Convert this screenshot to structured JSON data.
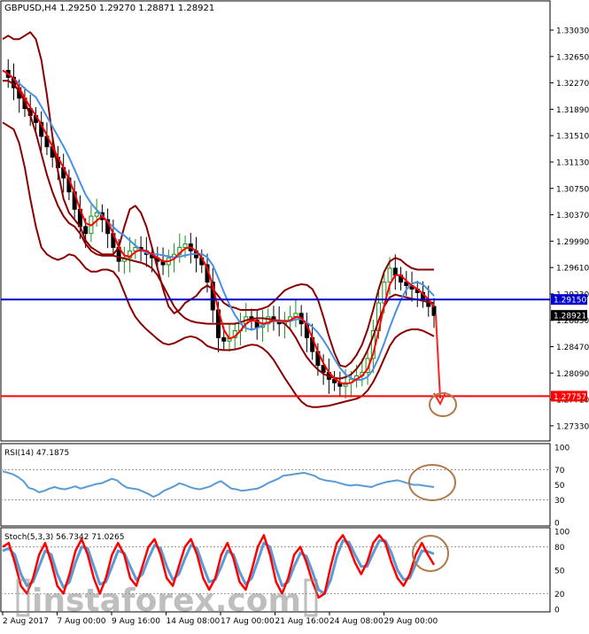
{
  "chart_data": {
    "type": "line",
    "title": "GBPUSD,H4  1.29250 1.29270 1.28871 1.28921",
    "main": {
      "ylim": [
        1.2715,
        1.334
      ],
      "yticks": [
        "1.33030",
        "1.32650",
        "1.32270",
        "1.31890",
        "1.31510",
        "1.31130",
        "1.30750",
        "1.30370",
        "1.29990",
        "1.29610",
        "1.29230",
        "1.28850",
        "1.28470",
        "1.28090",
        "1.27710",
        "1.27330"
      ],
      "levels": [
        {
          "name": "resistance",
          "value": 1.2915,
          "label": "1.29150",
          "color": "#0000cc"
        },
        {
          "name": "support",
          "value": 1.27757,
          "label": "1.27757",
          "color": "#ff0000"
        },
        {
          "name": "last",
          "value": 1.28921,
          "label": "1.28921",
          "color": "#000000"
        }
      ],
      "close": [
        1.3245,
        1.3235,
        1.322,
        1.3205,
        1.319,
        1.318,
        1.317,
        1.315,
        1.3135,
        1.312,
        1.3105,
        1.309,
        1.307,
        1.3045,
        1.302,
        1.301,
        1.3035,
        1.304,
        1.303,
        1.301,
        1.299,
        1.297,
        1.2975,
        1.2985,
        1.299,
        1.2985,
        1.298,
        1.2975,
        1.297,
        1.2965,
        1.2975,
        1.298,
        1.299,
        1.2995,
        1.2985,
        1.2975,
        1.2965,
        1.294,
        1.29,
        1.286,
        1.2855,
        1.286,
        1.287,
        1.288,
        1.289,
        1.2885,
        1.2875,
        1.288,
        1.289,
        1.2885,
        1.288,
        1.2885,
        1.289,
        1.2895,
        1.288,
        1.286,
        1.284,
        1.282,
        1.281,
        1.28,
        1.2795,
        1.279,
        1.2795,
        1.28,
        1.2805,
        1.281,
        1.283,
        1.287,
        1.291,
        1.294,
        1.296,
        1.295,
        1.294,
        1.2935,
        1.293,
        1.2925,
        1.2915,
        1.2905,
        1.2892
      ],
      "upper_band": [
        1.329,
        1.3295,
        1.329,
        1.329,
        1.3295,
        1.33,
        1.329,
        1.326,
        1.321,
        1.315,
        1.31,
        1.306,
        1.304,
        1.303,
        1.302,
        1.3,
        1.299,
        1.2985,
        1.298,
        1.298,
        1.298,
        1.299,
        1.302,
        1.3045,
        1.305,
        1.304,
        1.302,
        1.299,
        1.296,
        1.293,
        1.2905,
        1.2895,
        1.29,
        1.291,
        1.2915,
        1.292,
        1.293,
        1.2935,
        1.293,
        1.292,
        1.291,
        1.2905,
        1.2903,
        1.29,
        1.29,
        1.29,
        1.29,
        1.2902,
        1.2905,
        1.2912,
        1.292,
        1.2928,
        1.2932,
        1.2935,
        1.2937,
        1.2936,
        1.293,
        1.2915,
        1.289,
        1.2862,
        1.2838,
        1.282,
        1.2818,
        1.2824,
        1.2835,
        1.285,
        1.2872,
        1.29,
        1.293,
        1.2955,
        1.297,
        1.2975,
        1.2972,
        1.2965,
        1.296,
        1.2958,
        1.2958,
        1.2958,
        1.2958
      ],
      "middle_band": [
        1.323,
        1.323,
        1.3225,
        1.3215,
        1.32,
        1.318,
        1.3155,
        1.3125,
        1.3095,
        1.307,
        1.305,
        1.3035,
        1.3025,
        1.302,
        1.301,
        1.2995,
        1.2985,
        1.298,
        1.2978,
        1.2978,
        1.2978,
        1.2976,
        1.2974,
        1.2972,
        1.297,
        1.2968,
        1.2965,
        1.296,
        1.295,
        1.2935,
        1.292,
        1.2905,
        1.2895,
        1.2888,
        1.2884,
        1.2882,
        1.2881,
        1.288,
        1.288,
        1.288,
        1.288,
        1.288,
        1.288,
        1.2882,
        1.2885,
        1.2887,
        1.2888,
        1.2888,
        1.2887,
        1.2886,
        1.2884,
        1.288,
        1.2872,
        1.286,
        1.2845,
        1.2832,
        1.2822,
        1.2814,
        1.2808,
        1.2804,
        1.2802,
        1.2801,
        1.2803,
        1.2807,
        1.2815,
        1.2826,
        1.2842,
        1.2862,
        1.2885,
        1.2905,
        1.2918,
        1.2922,
        1.292,
        1.2918,
        1.2916,
        1.2915,
        1.2913,
        1.2911,
        1.291
      ],
      "lower_band": [
        1.317,
        1.3165,
        1.316,
        1.314,
        1.3105,
        1.306,
        1.302,
        1.299,
        1.298,
        1.2975,
        1.2972,
        1.2975,
        1.298,
        1.2978,
        1.297,
        1.296,
        1.2955,
        1.2955,
        1.2958,
        1.2958,
        1.2955,
        1.2945,
        1.2925,
        1.2905,
        1.289,
        1.288,
        1.2872,
        1.2865,
        1.2858,
        1.2852,
        1.285,
        1.2852,
        1.2856,
        1.286,
        1.2862,
        1.286,
        1.2855,
        1.2848,
        1.2845,
        1.2843,
        1.2842,
        1.2842,
        1.2843,
        1.2845,
        1.2848,
        1.285,
        1.2849,
        1.2845,
        1.2838,
        1.2828,
        1.2815,
        1.2802,
        1.279,
        1.2778,
        1.2768,
        1.2762,
        1.276,
        1.276,
        1.2761,
        1.2762,
        1.2764,
        1.2766,
        1.2768,
        1.277,
        1.2772,
        1.2776,
        1.2784,
        1.2796,
        1.2812,
        1.283,
        1.2848,
        1.286,
        1.2866,
        1.287,
        1.2872,
        1.2872,
        1.287,
        1.2866,
        1.2862
      ]
    },
    "rsi": {
      "label": "RSI(14) 47.1875",
      "ylim": [
        0,
        100
      ],
      "yticks": [
        "100",
        "70",
        "50",
        "30",
        "0"
      ],
      "values": [
        68,
        66,
        64,
        60,
        55,
        46,
        44,
        40,
        42,
        45,
        47,
        45,
        44,
        46,
        48,
        45,
        47,
        49,
        51,
        52,
        55,
        58,
        56,
        50,
        46,
        45,
        44,
        41,
        38,
        34,
        37,
        42,
        45,
        48,
        52,
        50,
        47,
        45,
        44,
        46,
        48,
        52,
        55,
        50,
        45,
        44,
        42,
        43,
        44,
        45,
        48,
        52,
        55,
        58,
        62,
        63,
        64,
        65,
        66,
        64,
        62,
        58,
        56,
        55,
        54,
        52,
        50,
        49,
        50,
        49,
        48,
        47,
        50,
        52,
        54,
        55,
        56,
        54,
        52,
        50,
        50,
        49,
        48,
        47
      ]
    },
    "stoch": {
      "label": "Stoch(5,3,3) 56.7342 71.0265",
      "ylim": [
        0,
        100
      ],
      "yticks": [
        "100",
        "80",
        "50",
        "20",
        "0"
      ],
      "k": [
        80,
        85,
        60,
        30,
        20,
        40,
        70,
        85,
        60,
        30,
        20,
        45,
        75,
        90,
        70,
        40,
        20,
        40,
        70,
        85,
        70,
        40,
        30,
        55,
        80,
        90,
        70,
        40,
        30,
        55,
        80,
        90,
        70,
        40,
        25,
        40,
        70,
        85,
        65,
        35,
        25,
        50,
        80,
        95,
        70,
        35,
        20,
        40,
        70,
        80,
        60,
        35,
        15,
        20,
        55,
        85,
        95,
        80,
        60,
        45,
        60,
        85,
        95,
        85,
        60,
        40,
        30,
        45,
        70,
        85,
        70,
        57
      ],
      "d": [
        75,
        78,
        70,
        45,
        30,
        35,
        55,
        75,
        70,
        45,
        28,
        35,
        60,
        80,
        78,
        55,
        32,
        35,
        55,
        75,
        72,
        55,
        38,
        45,
        65,
        82,
        78,
        55,
        38,
        45,
        65,
        82,
        78,
        55,
        35,
        38,
        55,
        75,
        70,
        48,
        32,
        40,
        62,
        85,
        80,
        52,
        30,
        35,
        55,
        72,
        68,
        48,
        25,
        20,
        38,
        68,
        88,
        86,
        70,
        55,
        55,
        72,
        88,
        88,
        72,
        50,
        38,
        40,
        58,
        75,
        74,
        71
      ]
    },
    "xticks": [
      "2 Aug 2017",
      "7 Aug 00:00",
      "9 Aug 16:00",
      "14 Aug 08:00",
      "17 Aug 00:00",
      "21 Aug 16:00",
      "24 Aug 08:00",
      "29 Aug 00:00"
    ],
    "watermark": "instaforex.com",
    "colors": {
      "bands": "#8b0000",
      "fast_ma": "#ff0000",
      "slow_ma": "#4a90e2",
      "rsi": "#5b9bd5",
      "stoch_k": "#ff0000",
      "stoch_d": "#5b9bd5",
      "circle": "#b07a4a",
      "bull_candle": "#1a8f1a",
      "bear_candle": "#000000"
    }
  }
}
